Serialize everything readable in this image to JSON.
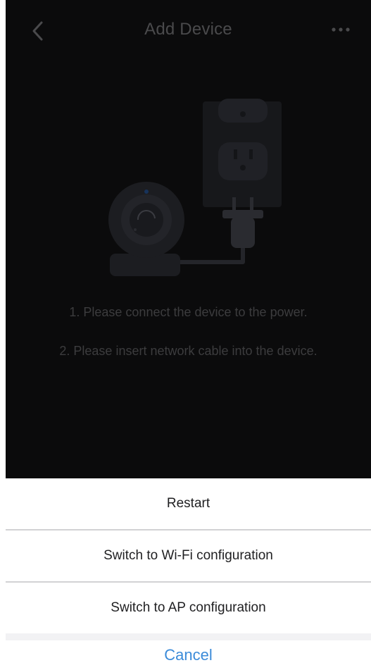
{
  "nav": {
    "title": "Add Device",
    "back_icon": "chevron-left-icon",
    "more_icon": "more-horizontal-icon"
  },
  "instructions": [
    "1. Please connect the device to the power.",
    "2. Please insert network cable into the device."
  ],
  "action_sheet": {
    "items": [
      {
        "label": "Restart"
      },
      {
        "label": "Switch to Wi-Fi configuration"
      },
      {
        "label": "Switch to AP configuration"
      }
    ],
    "cancel_label": "Cancel"
  },
  "colors": {
    "overlay_background": "#0b0b0c",
    "sheet_background": "#ffffff",
    "divider": "#d2d2d4",
    "cancel_accent": "#3b8bd9",
    "dim_text": "#3c3c3e"
  }
}
